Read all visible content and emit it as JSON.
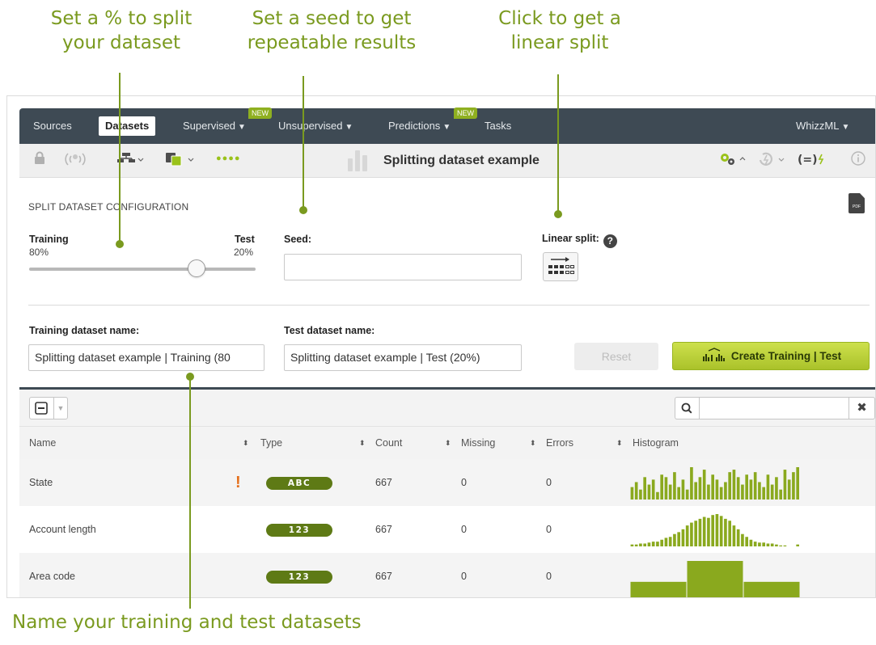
{
  "callouts": [
    {
      "line1": "Set a % to split",
      "line2": "your dataset"
    },
    {
      "line1": "Set a seed to get",
      "line2": "repeatable results"
    },
    {
      "line1": "Click to get a",
      "line2": "linear split"
    },
    {
      "line1": "Name your training and test datasets"
    }
  ],
  "nav": {
    "sources": "Sources",
    "datasets": "Datasets",
    "supervised": "Supervised",
    "unsupervised": "Unsupervised",
    "predictions": "Predictions",
    "tasks": "Tasks",
    "whizzml": "WhizzML",
    "new_badge": "NEW",
    "caret": "▼"
  },
  "toolbar": {
    "title": "Splitting dataset example",
    "dots": "●●●●"
  },
  "config": {
    "section_title": "SPLIT DATASET CONFIGURATION",
    "pdf_label": "PDF",
    "training_label": "Training",
    "training_pct": "80%",
    "test_label": "Test",
    "test_pct": "20%",
    "split_training_fraction": 0.8,
    "seed_label": "Seed:",
    "seed_value": "",
    "linear_label": "Linear split:",
    "help": "?",
    "training_name_label": "Training dataset name:",
    "training_name_value": "Splitting dataset example | Training (80",
    "test_name_label": "Test dataset name:",
    "test_name_value": "Splitting dataset example | Test (20%)",
    "reset_label": "Reset",
    "create_label": "Create Training | Test"
  },
  "table": {
    "search_value": "",
    "clear": "✖",
    "columns": [
      "Name",
      "Type",
      "Count",
      "Missing",
      "Errors",
      "Histogram"
    ],
    "sort_glyph": "⬍",
    "rows": [
      {
        "name": "State",
        "warning": "!",
        "type": "ABC",
        "count": "667",
        "missing": "0",
        "errors": "0",
        "histogram": [
          5,
          7,
          4,
          9,
          6,
          8,
          3,
          10,
          9,
          6,
          11,
          5,
          8,
          4,
          13,
          7,
          9,
          12,
          6,
          10,
          8,
          5,
          7,
          11,
          12,
          9,
          6,
          10,
          8,
          11,
          7,
          5,
          10,
          6,
          9,
          4,
          12,
          8,
          11,
          13
        ]
      },
      {
        "name": "Account length",
        "warning": "",
        "type": "123",
        "count": "667",
        "missing": "0",
        "errors": "0",
        "histogram": [
          2,
          2,
          3,
          3,
          4,
          5,
          5,
          7,
          9,
          10,
          13,
          15,
          18,
          22,
          25,
          27,
          29,
          31,
          30,
          33,
          34,
          32,
          29,
          27,
          22,
          18,
          13,
          10,
          7,
          5,
          4,
          4,
          3,
          3,
          2,
          1,
          1,
          0,
          0,
          2
        ]
      },
      {
        "name": "Area code",
        "warning": "",
        "type": "123",
        "count": "667",
        "missing": "0",
        "errors": "0",
        "histogram": [
          24,
          52,
          24
        ]
      }
    ]
  },
  "colors": {
    "accent": "#7a9a1f",
    "nav_bg": "#3e4a54",
    "histogram": "#8aa91e",
    "type_pill": "#5e7a15",
    "warning": "#e46f1c"
  }
}
